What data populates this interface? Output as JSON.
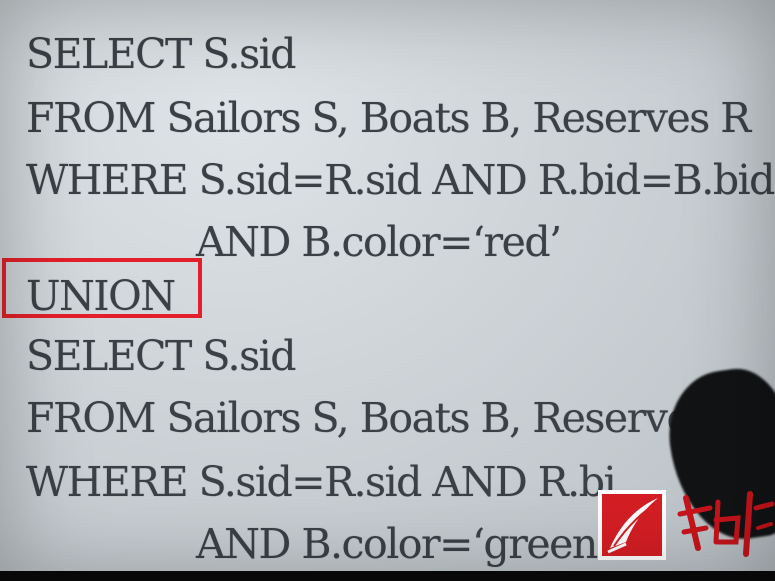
{
  "slide": {
    "lines": [
      "SELECT S.sid",
      "FROM Sailors S, Boats B, Reserves R",
      "WHERE S.sid=R.sid AND R.bid=B.bid",
      "AND B.color=‘red’",
      "UNION",
      "SELECT S.sid",
      "FROM Sailors S, Boats B, Reserves",
      "WHERE S.sid=R.sid AND R.bi",
      "AND B.color=‘green’"
    ]
  },
  "colors": {
    "highlight": "#e3202a",
    "text": "#3b4046",
    "logo": "#d41e24"
  },
  "icons": {
    "logo": "red-quill-logo",
    "watermark": "red-brush-calligraphy-mark"
  }
}
